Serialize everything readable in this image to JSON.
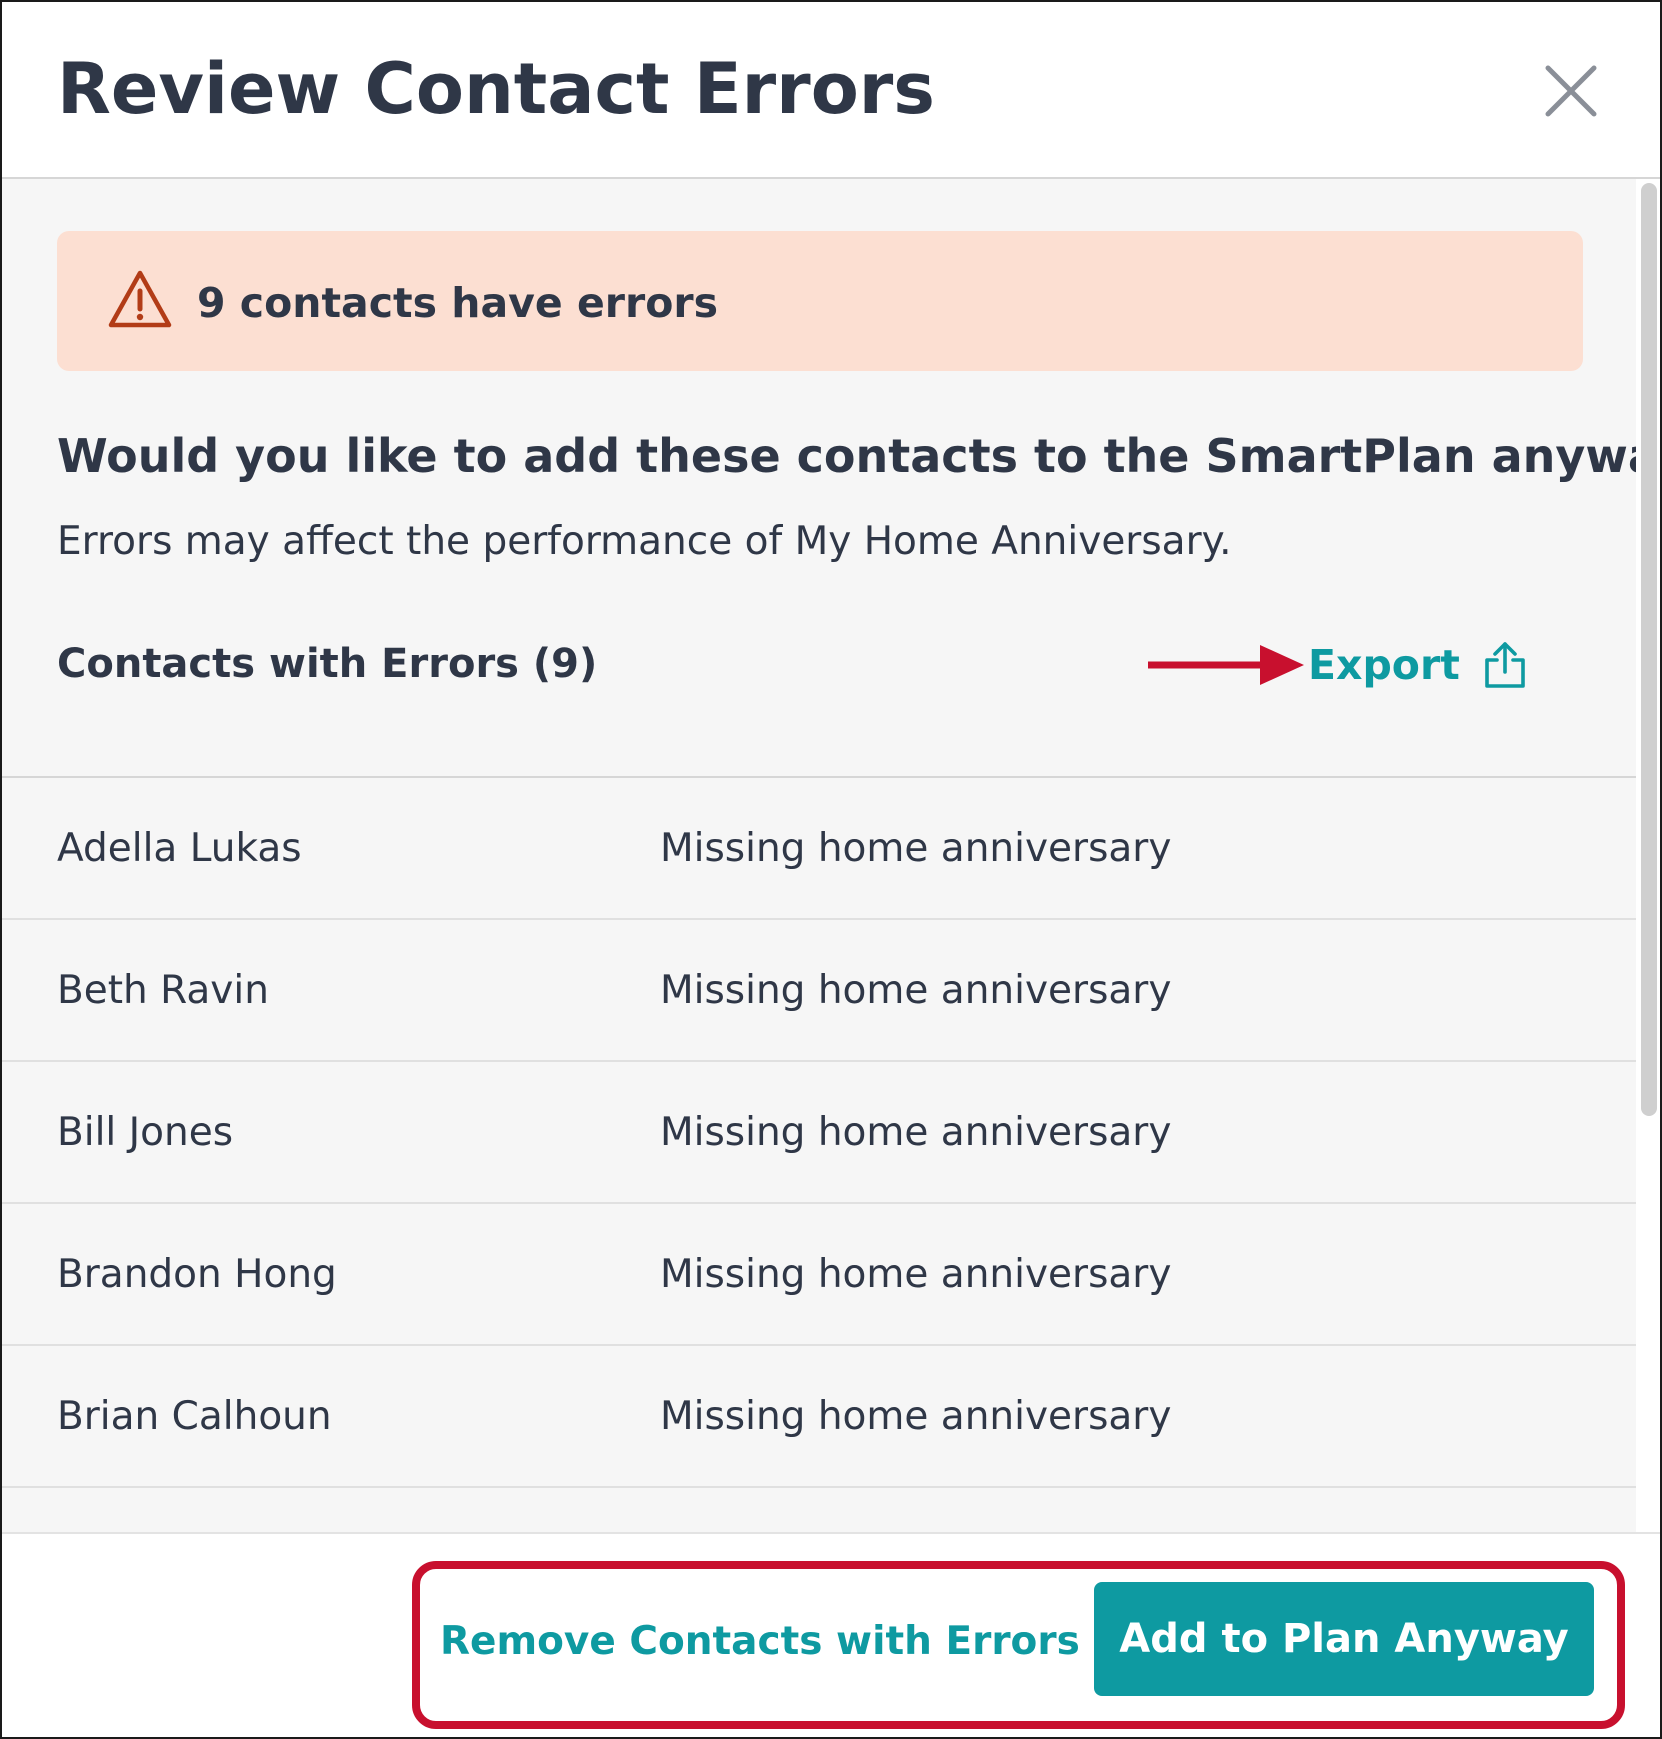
{
  "modal": {
    "title": "Review Contact Errors"
  },
  "alert": {
    "text": "9 contacts have errors",
    "icon": "warning-triangle-icon",
    "background": "#fcdfd2",
    "icon_color": "#b23c17"
  },
  "prompt": {
    "question": "Would you like to add these contacts to the SmartPlan anyway?",
    "description": "Errors may affect the performance of My Home Anniversary."
  },
  "list": {
    "heading": "Contacts with Errors (9)",
    "export_label": "Export",
    "export_icon": "share-upload-icon",
    "rows": [
      {
        "name": "Adella Lukas",
        "error": "Missing home anniversary"
      },
      {
        "name": "Beth Ravin",
        "error": "Missing home anniversary"
      },
      {
        "name": "Bill Jones",
        "error": "Missing home anniversary"
      },
      {
        "name": "Brandon Hong",
        "error": "Missing home anniversary"
      },
      {
        "name": "Brian Calhoun",
        "error": "Missing home anniversary"
      }
    ]
  },
  "footer": {
    "remove_label": "Remove Contacts with Errors",
    "add_label": "Add to Plan Anyway"
  },
  "colors": {
    "accent": "#0e9aa1",
    "annotation_red": "#c8102e",
    "text": "#2f3747",
    "panel_bg": "#f6f6f6"
  }
}
